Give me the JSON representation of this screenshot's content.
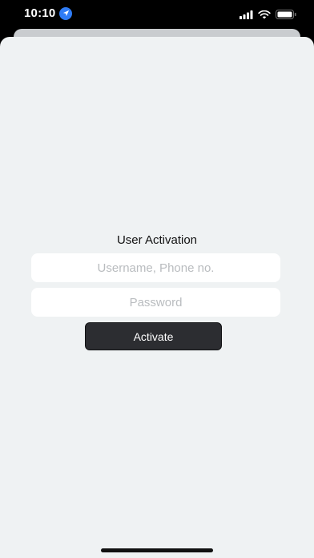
{
  "status_bar": {
    "time": "10:10",
    "icons": [
      "location-arrow-icon",
      "cellular-signal-icon",
      "wifi-icon",
      "battery-icon"
    ]
  },
  "form": {
    "title": "User Activation",
    "username_placeholder": "Username, Phone no.",
    "username_value": "",
    "password_placeholder": "Password",
    "password_value": "",
    "activate_label": "Activate"
  },
  "colors": {
    "sheet_background": "#eff2f3",
    "field_background": "#ffffff",
    "button_background": "#2c2d31",
    "button_text": "#ffffff",
    "location_badge": "#2f7cf6"
  }
}
